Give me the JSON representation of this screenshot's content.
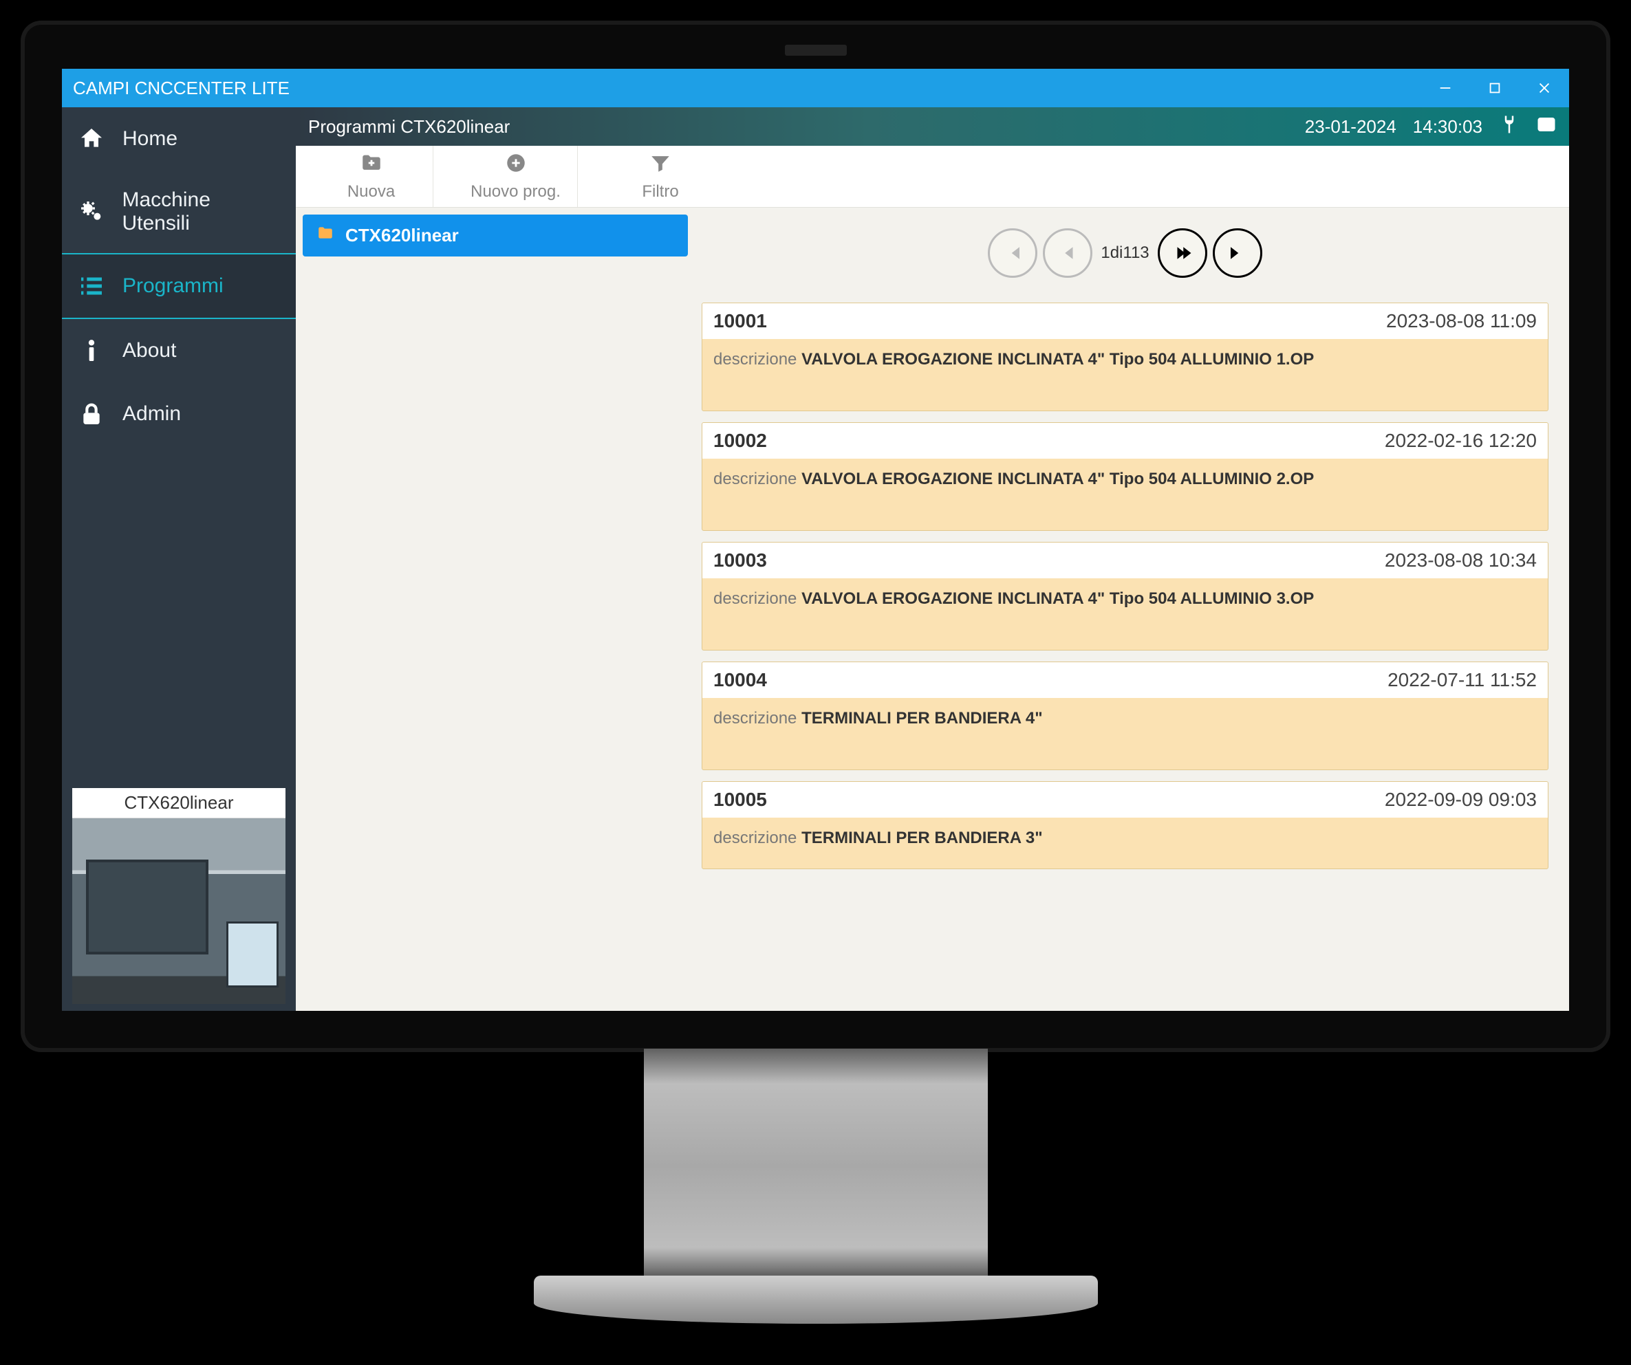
{
  "window": {
    "title": "CAMPI CNCCENTER LITE"
  },
  "sidebar": {
    "items": [
      {
        "label": "Home"
      },
      {
        "label": "Macchine Utensili"
      },
      {
        "label": "Programmi"
      },
      {
        "label": "About"
      },
      {
        "label": "Admin"
      }
    ],
    "thumbnail": {
      "title": "CTX620linear"
    }
  },
  "header": {
    "title": "Programmi CTX620linear",
    "date": "23-01-2024",
    "time": "14:30:03"
  },
  "toolbar": {
    "nuova": "Nuova",
    "nuovo_prog": "Nuovo prog.",
    "filtro": "Filtro"
  },
  "folder": {
    "name": "CTX620linear"
  },
  "pager": {
    "current": 1,
    "sep": "di",
    "total": 113,
    "text": "1di113"
  },
  "descr_label": "descrizione",
  "programs": [
    {
      "id": "10001",
      "date": "2023-08-08 11:09",
      "desc": "VALVOLA EROGAZIONE INCLINATA 4\" Tipo 504 ALLUMINIO 1.OP"
    },
    {
      "id": "10002",
      "date": "2022-02-16 12:20",
      "desc": "VALVOLA EROGAZIONE INCLINATA 4\" Tipo 504 ALLUMINIO 2.OP"
    },
    {
      "id": "10003",
      "date": "2023-08-08 10:34",
      "desc": "VALVOLA EROGAZIONE INCLINATA 4\" Tipo 504 ALLUMINIO 3.OP"
    },
    {
      "id": "10004",
      "date": "2022-07-11 11:52",
      "desc": "TERMINALI PER BANDIERA 4\""
    },
    {
      "id": "10005",
      "date": "2022-09-09 09:03",
      "desc": "TERMINALI PER BANDIERA 3\""
    }
  ]
}
